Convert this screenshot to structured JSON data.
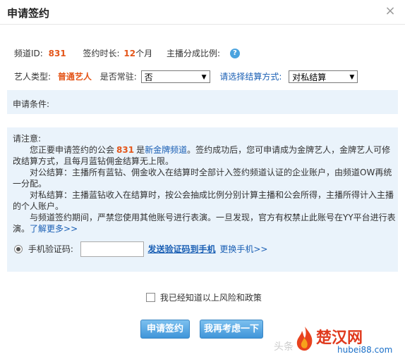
{
  "dialog": {
    "title": "申请签约",
    "close_symbol": "×"
  },
  "info": {
    "channel_label": "频道ID:",
    "channel_id": "831",
    "term_label": "签约时长:",
    "term_value": "12",
    "term_unit": "个月",
    "share_label": "主播分成比例:",
    "help_symbol": "?"
  },
  "settings": {
    "artist_type_label": "艺人类型:",
    "artist_type_value": "普通艺人",
    "resident_label": "是否常驻:",
    "resident_value": "否",
    "settlement_label": "请选择结算方式:",
    "settlement_value": "对私结算"
  },
  "conditions": {
    "label": "申请条件:"
  },
  "notice": {
    "heading": "请注意:",
    "p1_a": "您正要申请签约的公会",
    "p1_id": "831",
    "p1_b": "是",
    "p1_link": "新金牌频道",
    "p1_c": "。签约成功后，您可申请成为金牌艺人，金牌艺人可修改结算方式，且每月蓝钻佣金结算无上限。",
    "p2": "对公结算：主播所有蓝钻、佣金收入在结算时全部计入签约频道认证的企业账户，由频道OW再统一分配。",
    "p3": "对私结算：主播蓝钻收入在结算时，按公会抽成比例分别计算主播和公会所得，主播所得计入主播的个人账户。",
    "p4": "与频道签约期间，严禁您使用其他账号进行表演。一旦发现，官方有权禁止此账号在YY平台进行表演。",
    "learn_more": "了解更多>>"
  },
  "verify": {
    "label": "手机验证码:",
    "input_value": "",
    "send_code": "发送验证码到手机",
    "change_phone": "更换手机>>"
  },
  "agree": {
    "label": "我已经知道以上风险和政策"
  },
  "buttons": {
    "apply": "申请签约",
    "reconsider": "我再考虑一下"
  },
  "watermark": {
    "toutiao": "头条",
    "brand": "楚汉网",
    "url": "hubei88.com"
  }
}
